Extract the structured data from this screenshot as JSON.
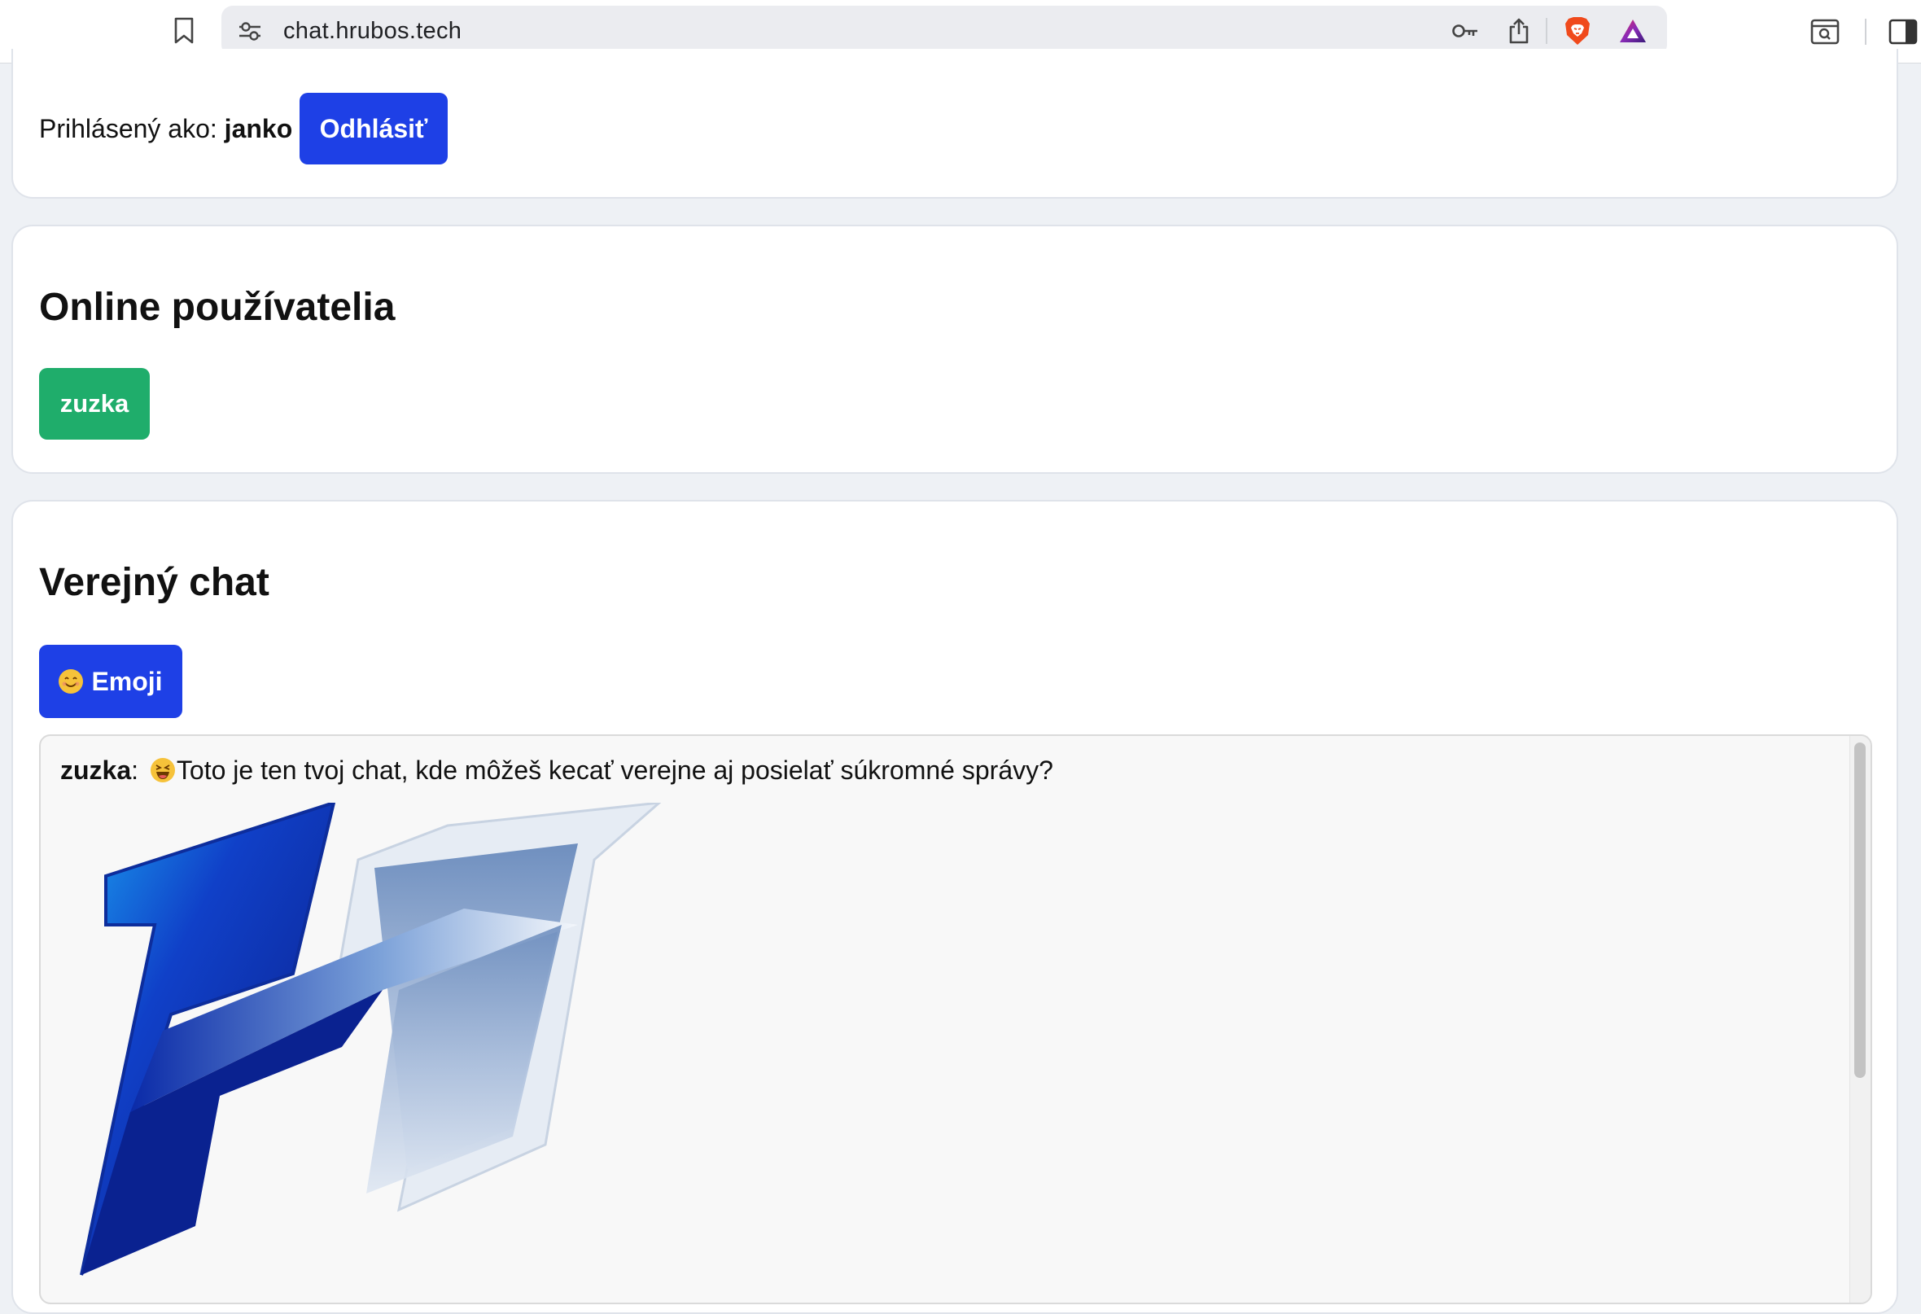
{
  "browser": {
    "url": "chat.hrubos.tech"
  },
  "header": {
    "logged_in_label": "Prihlásený ako:",
    "username": "janko",
    "logout_label": "Odhlásiť"
  },
  "online": {
    "title": "Online používatelia",
    "users": [
      "zuzka"
    ]
  },
  "public_chat": {
    "title": "Verejný chat",
    "emoji_button_label": "Emoji",
    "messages": [
      {
        "author": "zuzka",
        "separator": ":",
        "text": "Toto je ten tvoj chat, kde môžeš kecať verejne aj posielať súkromné správy?"
      }
    ]
  },
  "colors": {
    "primary_button": "#1e40e6",
    "online_chip": "#1fad6b",
    "page_bg": "#eef1f5"
  }
}
